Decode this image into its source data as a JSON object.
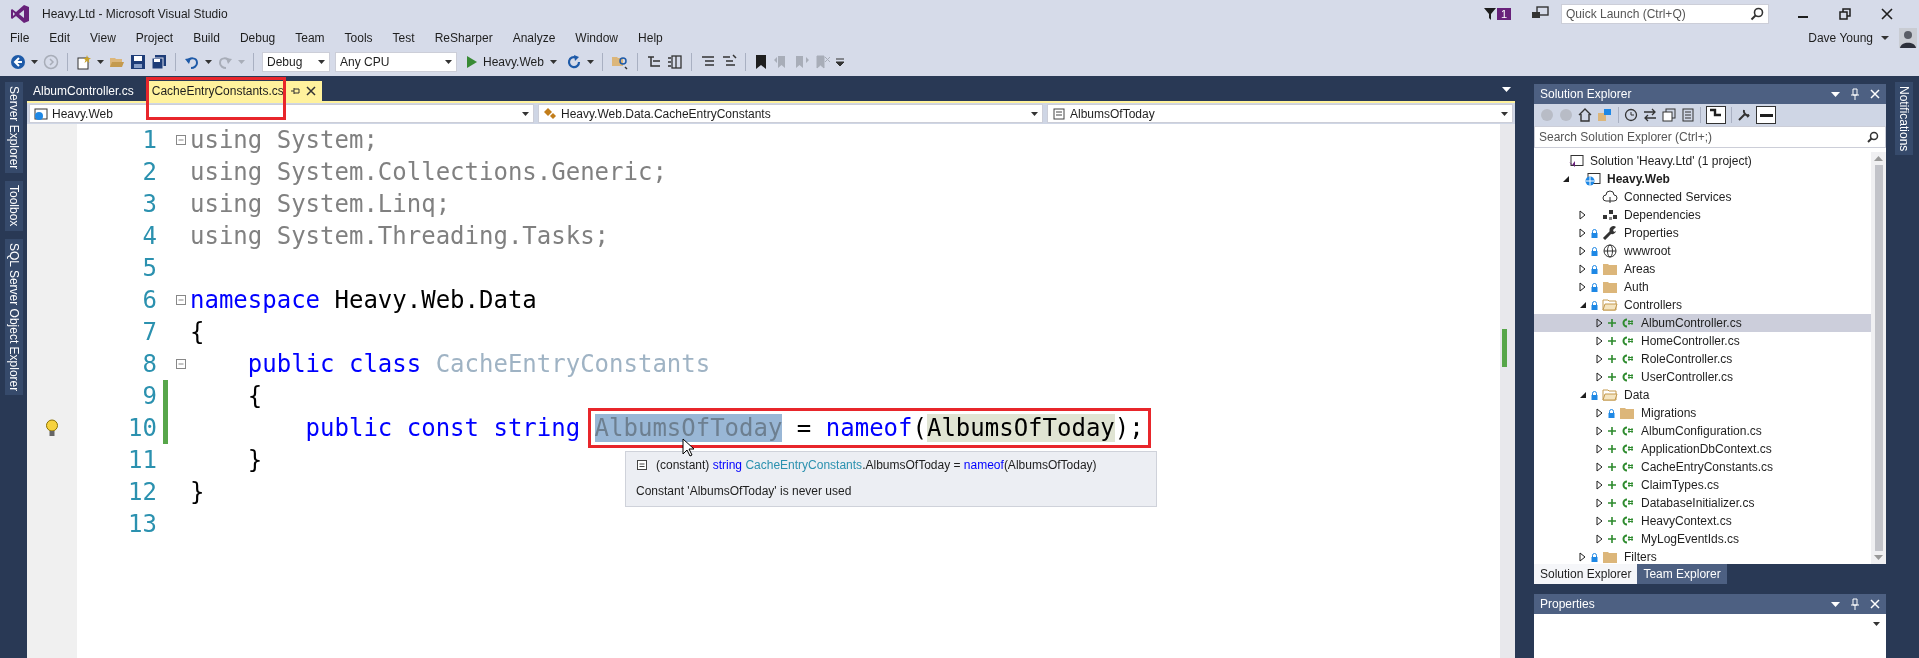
{
  "window": {
    "title": "Heavy.Ltd - Microsoft Visual Studio"
  },
  "title_bar": {
    "notification_count": "1",
    "quick_launch": {
      "placeholder": "Quick Launch (Ctrl+Q)"
    },
    "user": "Dave Young"
  },
  "menu": [
    "File",
    "Edit",
    "View",
    "Project",
    "Build",
    "Debug",
    "Team",
    "Tools",
    "Test",
    "ReSharper",
    "Analyze",
    "Window",
    "Help"
  ],
  "toolbar": {
    "configuration": "Debug",
    "platform": "Any CPU",
    "start_target": "Heavy.Web"
  },
  "left_tool_tabs": [
    "Server Explorer",
    "Toolbox",
    "SQL Server Object Explorer"
  ],
  "document_tabs": [
    {
      "label": "AlbumController.cs",
      "selected": false,
      "annotated": false
    },
    {
      "label": "CacheEntryConstants.cs",
      "selected": true,
      "annotated": true
    }
  ],
  "navigation_bar": [
    {
      "label": "Heavy.Web",
      "kind": "project"
    },
    {
      "label": "Heavy.Web.Data.CacheEntryConstants",
      "kind": "class"
    },
    {
      "label": "AlbumsOfToday",
      "kind": "member"
    }
  ],
  "editor": {
    "lines": [
      {
        "number": "1",
        "collapsible": true,
        "tokens": [
          {
            "text": "using System;",
            "kind": "unused"
          }
        ]
      },
      {
        "number": "2",
        "tokens": [
          {
            "text": "using System.Collections.Generic;",
            "kind": "unused"
          }
        ]
      },
      {
        "number": "3",
        "tokens": [
          {
            "text": "using System.Linq;",
            "kind": "unused"
          }
        ]
      },
      {
        "number": "4",
        "tokens": [
          {
            "text": "using System.Threading.Tasks;",
            "kind": "unused"
          }
        ]
      },
      {
        "number": "5"
      },
      {
        "number": "6",
        "collapsible": true,
        "tokens": [
          {
            "text": "namespace",
            "kind": "keyword"
          },
          {
            "text": " Heavy.Web.Data",
            "kind": "plain"
          }
        ]
      },
      {
        "number": "7",
        "tokens": [
          {
            "text": "{",
            "kind": "plain"
          }
        ]
      },
      {
        "number": "8",
        "collapsible": true,
        "tokens": [
          {
            "text": "    public class",
            "kind": "keyword"
          },
          {
            "text": " CacheEntryConstants",
            "kind": "unused_type"
          }
        ]
      },
      {
        "number": "9",
        "changed": true,
        "tokens": [
          {
            "text": "    {",
            "kind": "plain"
          }
        ]
      },
      {
        "number": "10",
        "changed": true,
        "lightbulb": true,
        "tokens": [
          {
            "text": "        public const string ",
            "kind": "keyword"
          },
          {
            "text": "AlbumsOfToday",
            "kind": "selected",
            "annotated": true
          },
          {
            "text": " = ",
            "kind": "plain",
            "annotated": true
          },
          {
            "text": "nameof",
            "kind": "keyword",
            "annotated": true
          },
          {
            "text": "(",
            "kind": "plain",
            "annotated": true
          },
          {
            "text": "AlbumsOfToday",
            "kind": "reference",
            "annotated": true
          },
          {
            "text": ");",
            "kind": "plain",
            "annotated": true
          }
        ]
      },
      {
        "number": "11",
        "tokens": [
          {
            "text": "    }",
            "kind": "plain"
          }
        ]
      },
      {
        "number": "12",
        "tokens": [
          {
            "text": "}",
            "kind": "plain"
          }
        ]
      },
      {
        "number": "13"
      }
    ],
    "tooltip": {
      "signature": [
        {
          "text": "(constant) ",
          "kind": "plain"
        },
        {
          "text": "string ",
          "kind": "keyword"
        },
        {
          "text": "CacheEntryConstants",
          "kind": "type"
        },
        {
          "text": ".AlbumsOfToday = ",
          "kind": "plain"
        },
        {
          "text": "nameof",
          "kind": "keyword"
        },
        {
          "text": "(AlbumsOfToday)",
          "kind": "plain"
        }
      ],
      "message": "Constant 'AlbumsOfToday' is never used"
    }
  },
  "solution_explorer": {
    "title": "Solution Explorer",
    "search": {
      "placeholder": "Search Solution Explorer (Ctrl+;)"
    },
    "tree": [
      {
        "label": "Solution 'Heavy.Ltd' (1 project)",
        "kind": "solution",
        "selected": false,
        "children": [
          {
            "label": "Heavy.Web",
            "kind": "project",
            "expanded": true,
            "selected": false,
            "children": [
              {
                "label": "Connected Services",
                "kind": "cloud",
                "selected": false
              },
              {
                "label": "Dependencies",
                "kind": "dependencies",
                "expanded": false,
                "selected": false
              },
              {
                "label": "Properties",
                "kind": "wrench",
                "locked": true,
                "expanded": false,
                "selected": false
              },
              {
                "label": "wwwroot",
                "kind": "globe",
                "locked": true,
                "expanded": false,
                "selected": false
              },
              {
                "label": "Areas",
                "kind": "folder",
                "locked": true,
                "expanded": false,
                "selected": false
              },
              {
                "label": "Auth",
                "kind": "folder",
                "locked": true,
                "expanded": false,
                "selected": false
              },
              {
                "label": "Controllers",
                "kind": "folder",
                "locked": true,
                "expanded": true,
                "selected": false,
                "children": [
                  {
                    "label": "AlbumController.cs",
                    "kind": "csharp",
                    "added": true,
                    "expanded": false,
                    "selected": true
                  },
                  {
                    "label": "HomeController.cs",
                    "kind": "csharp",
                    "added": true,
                    "expanded": false,
                    "selected": false
                  },
                  {
                    "label": "RoleController.cs",
                    "kind": "csharp",
                    "added": true,
                    "expanded": false,
                    "selected": false
                  },
                  {
                    "label": "UserController.cs",
                    "kind": "csharp",
                    "added": true,
                    "expanded": false,
                    "selected": false
                  }
                ]
              },
              {
                "label": "Data",
                "kind": "folder",
                "locked": true,
                "expanded": true,
                "selected": false,
                "children": [
                  {
                    "label": "Migrations",
                    "kind": "folder",
                    "locked": true,
                    "expanded": false,
                    "selected": false
                  },
                  {
                    "label": "AlbumConfiguration.cs",
                    "kind": "csharp",
                    "added": true,
                    "expanded": false,
                    "selected": false
                  },
                  {
                    "label": "ApplicationDbContext.cs",
                    "kind": "csharp",
                    "added": true,
                    "expanded": false,
                    "selected": false
                  },
                  {
                    "label": "CacheEntryConstants.cs",
                    "kind": "csharp",
                    "added": true,
                    "expanded": false,
                    "selected": false
                  },
                  {
                    "label": "ClaimTypes.cs",
                    "kind": "csharp",
                    "added": true,
                    "expanded": false,
                    "selected": false
                  },
                  {
                    "label": "DatabaseInitializer.cs",
                    "kind": "csharp",
                    "added": true,
                    "expanded": false,
                    "selected": false
                  },
                  {
                    "label": "HeavyContext.cs",
                    "kind": "csharp",
                    "added": true,
                    "expanded": false,
                    "selected": false
                  },
                  {
                    "label": "MyLogEventIds.cs",
                    "kind": "csharp",
                    "added": true,
                    "expanded": false,
                    "selected": false
                  }
                ]
              },
              {
                "label": "Filters",
                "kind": "folder",
                "locked": true,
                "expanded": false,
                "selected": false
              }
            ]
          }
        ]
      }
    ],
    "tabs": [
      {
        "label": "Solution Explorer",
        "selected": true
      },
      {
        "label": "Team Explorer",
        "selected": false
      }
    ]
  },
  "properties": {
    "title": "Properties"
  },
  "right_tool_tabs": [
    "Notifications"
  ]
}
